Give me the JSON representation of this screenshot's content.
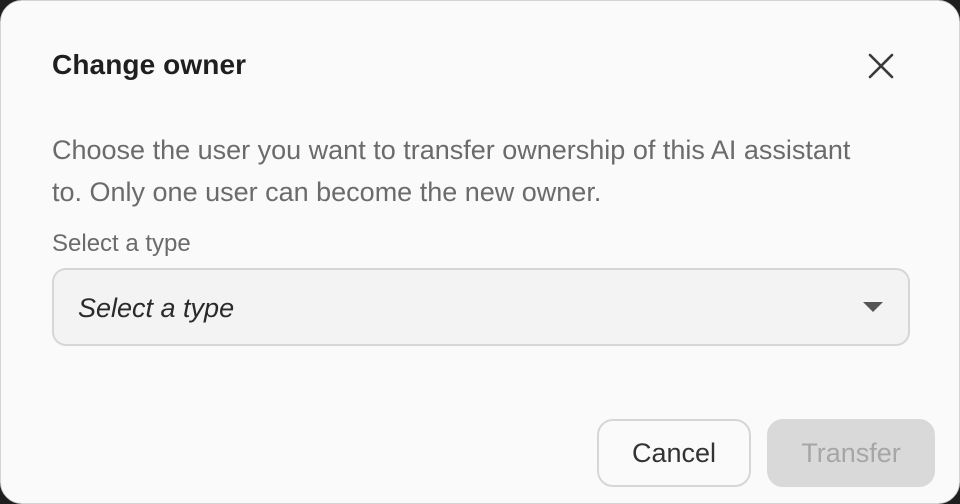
{
  "dialog": {
    "title": "Change owner",
    "description": "Choose the user you want to transfer ownership of this AI assistant to. Only one user can become the new owner.",
    "close_icon": "close-icon"
  },
  "field": {
    "label": "Select a type",
    "placeholder": "Select a type",
    "arrow_icon": "caret-down-icon"
  },
  "actions": {
    "cancel_label": "Cancel",
    "transfer_label": "Transfer",
    "transfer_disabled": true
  }
}
